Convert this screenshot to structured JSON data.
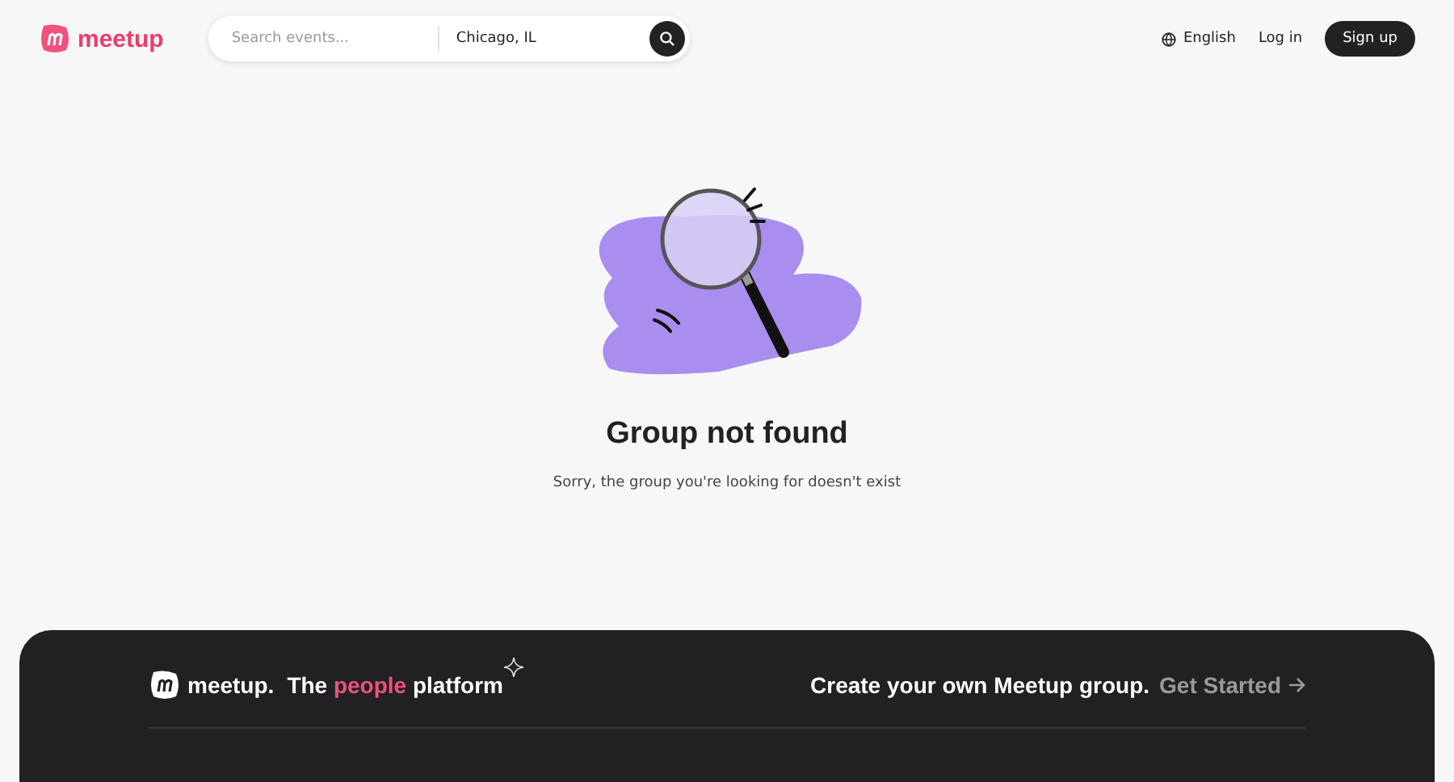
{
  "header": {
    "logo": "meetup",
    "search": {
      "placeholder": "Search events...",
      "location": "Chicago, IL"
    },
    "language": "English",
    "login": "Log in",
    "signup": "Sign up"
  },
  "message": {
    "title": "Group not found",
    "text": "Sorry, the group you're looking for doesn't exist"
  },
  "footer": {
    "logo": "meetup.",
    "tagline": {
      "before": "The",
      "highlight": "people",
      "after": "platform"
    },
    "cta": "Create your own Meetup group.",
    "link": "Get Started"
  }
}
